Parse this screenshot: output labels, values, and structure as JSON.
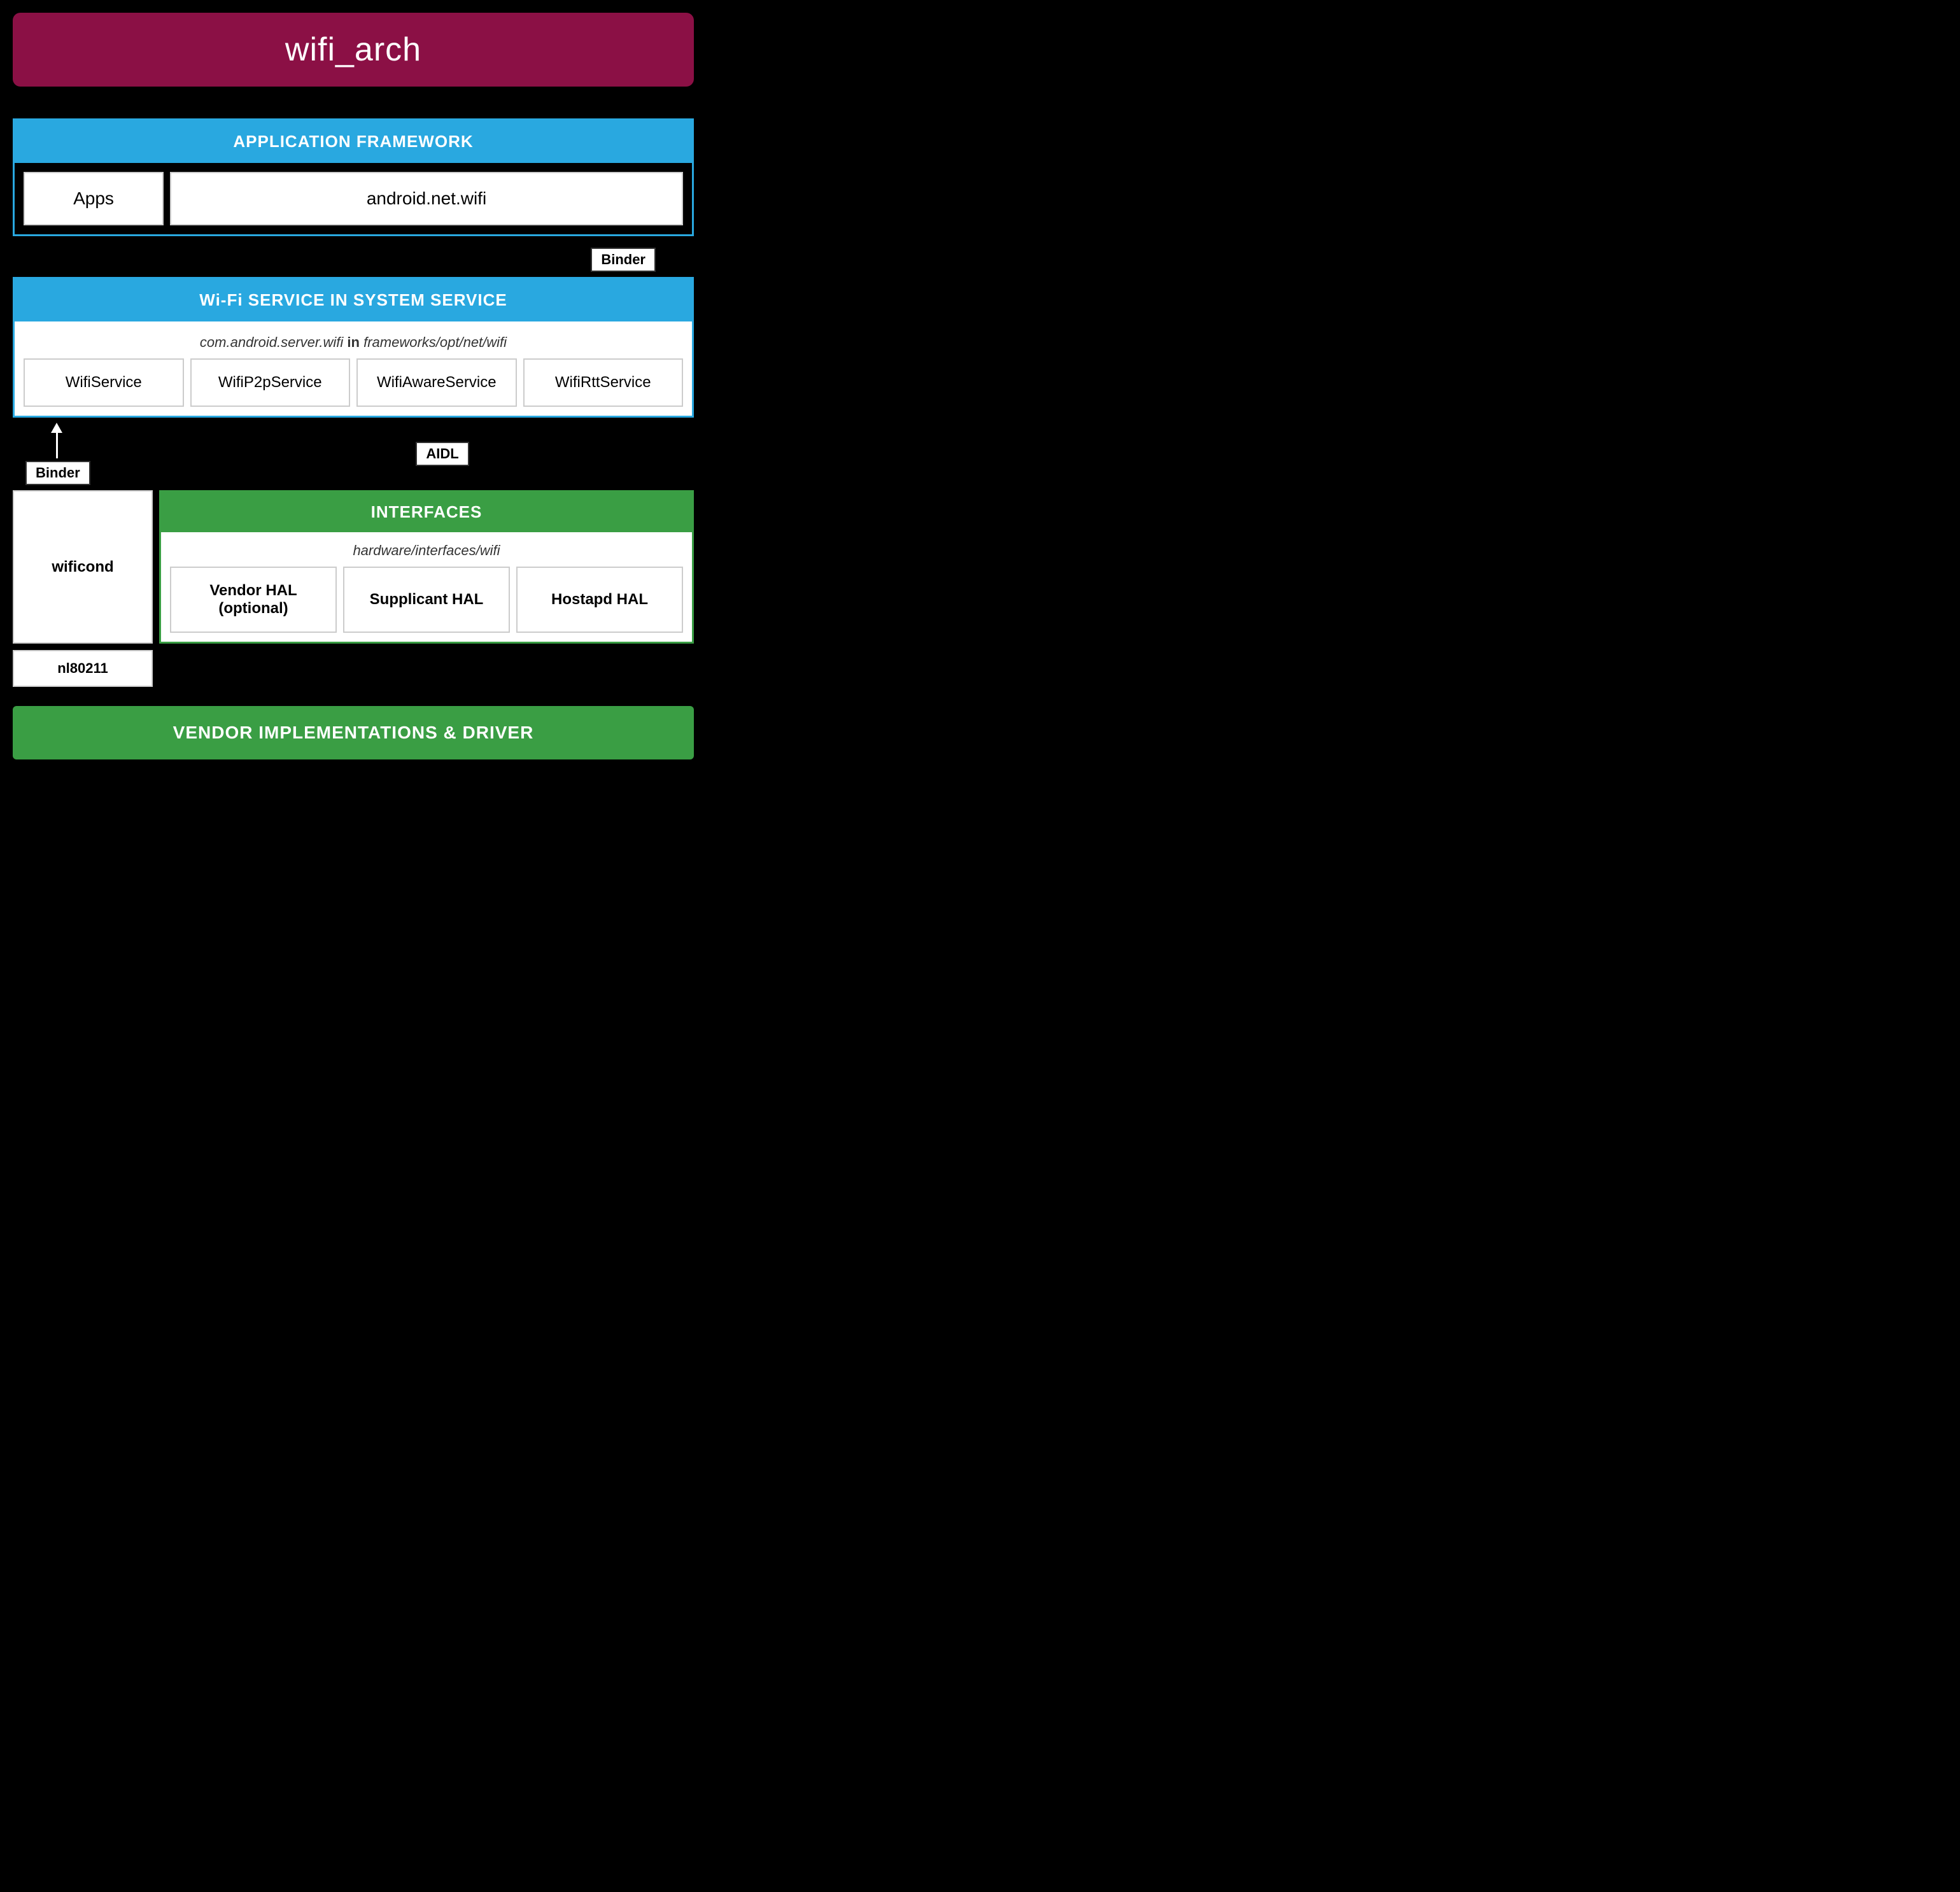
{
  "page": {
    "title": "wifi_arch",
    "background": "#000000"
  },
  "header": {
    "title": "wifi_arch",
    "bg_color": "#8b1045"
  },
  "app_framework": {
    "header": "APPLICATION FRAMEWORK",
    "apps_label": "Apps",
    "android_net_wifi_label": "android.net.wifi",
    "binder_label": "Binder"
  },
  "wifi_service": {
    "header": "Wi-Fi SERVICE IN SYSTEM SERVICE",
    "path_prefix": "com.android.server.wifi",
    "path_in": "in",
    "path_suffix": "frameworks/opt/net/wifi",
    "binder_label": "Binder",
    "aidl_label": "AIDL",
    "services": [
      {
        "label": "WifiService"
      },
      {
        "label": "WifiP2pService"
      },
      {
        "label": "WifiAwareService"
      },
      {
        "label": "WifiRttService"
      }
    ]
  },
  "wificond": {
    "label": "wificond"
  },
  "interfaces": {
    "header": "INTERFACES",
    "path": "hardware/interfaces/wifi",
    "hal_items": [
      {
        "label": "Vendor HAL (optional)"
      },
      {
        "label": "Supplicant HAL"
      },
      {
        "label": "Hostapd HAL"
      }
    ]
  },
  "nl80211": {
    "label": "nl80211"
  },
  "vendor": {
    "label": "VENDOR IMPLEMENTATIONS & DRIVER"
  }
}
